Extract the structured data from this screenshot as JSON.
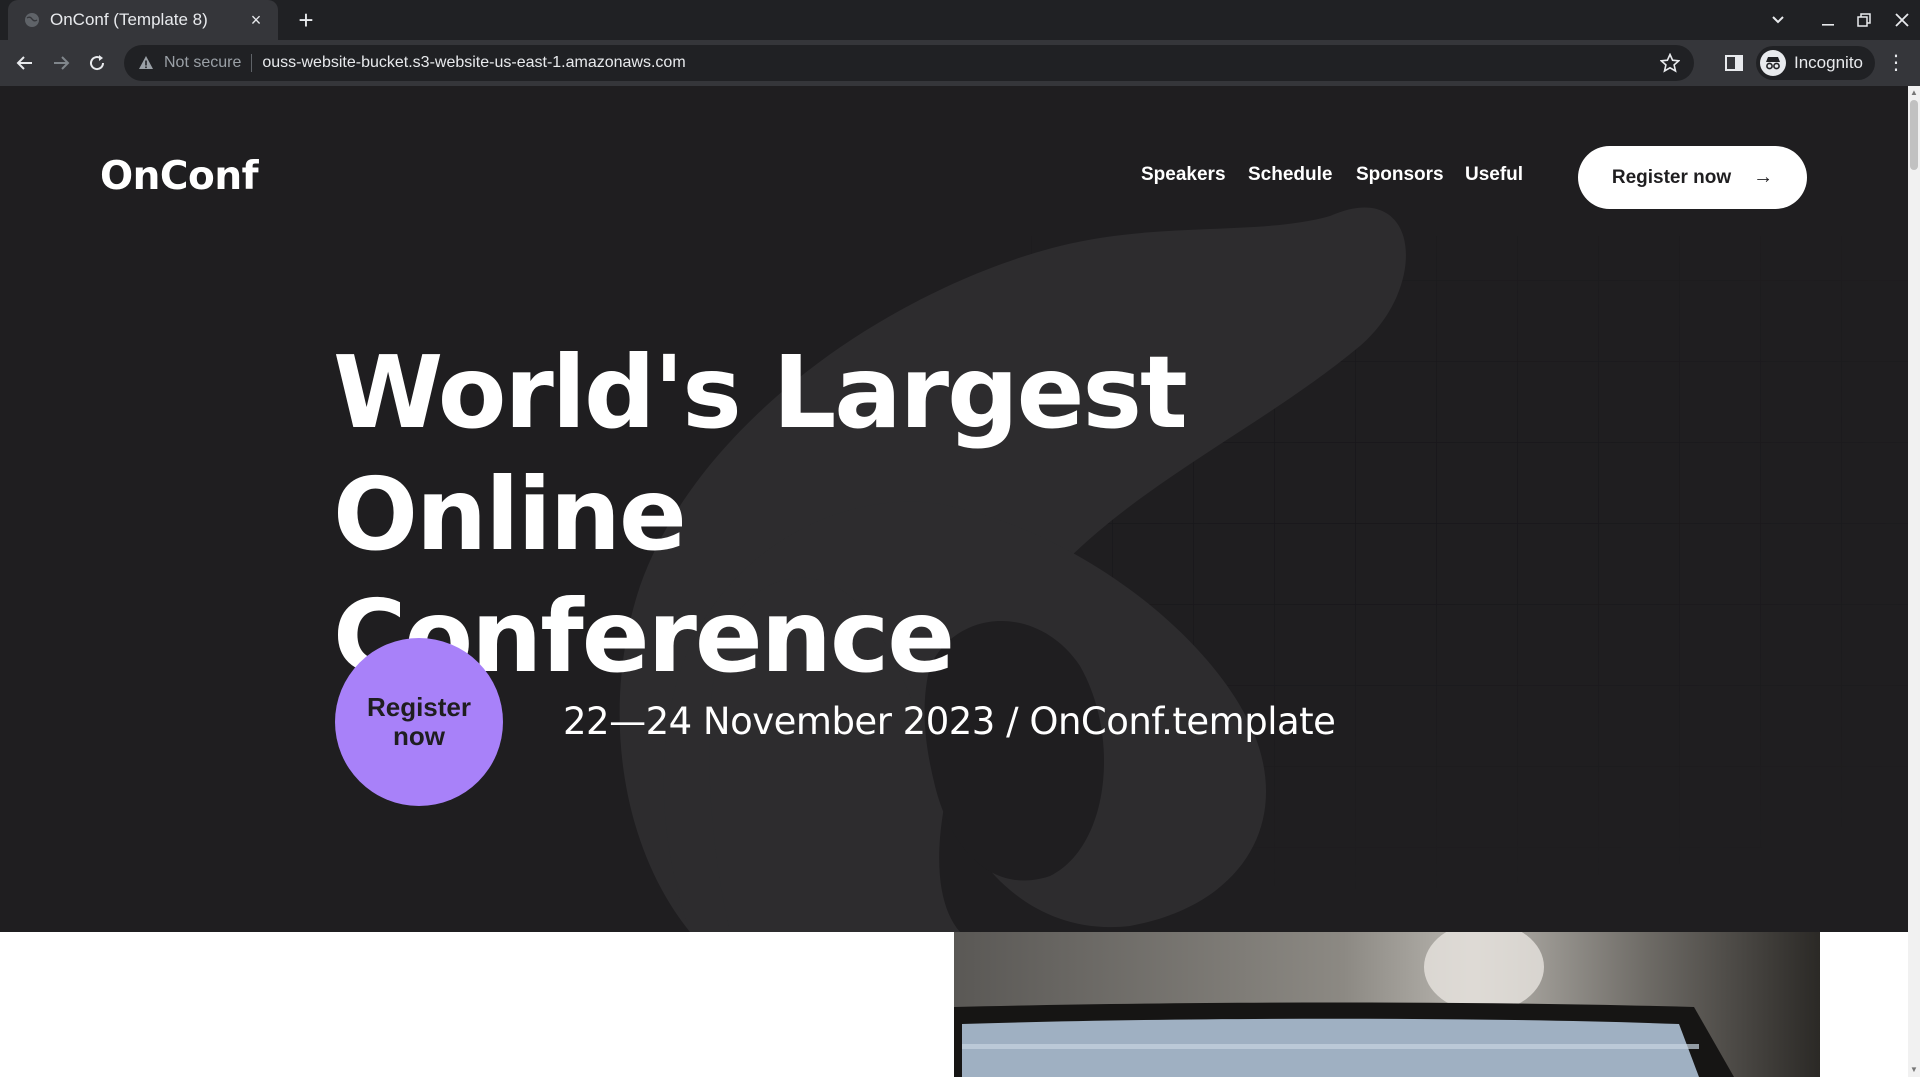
{
  "browser": {
    "tab_title": "OnConf (Template 8)",
    "tab_close": "×",
    "new_tab": "+",
    "security_label": "Not secure",
    "url": "ouss-website-bucket.s3-website-us-east-1.amazonaws.com",
    "profile_label": "Incognito",
    "menu_glyph": "⋮"
  },
  "site": {
    "logo": "OnConf",
    "nav": [
      "Speakers",
      "Schedule",
      "Sponsors",
      "Useful"
    ],
    "header_cta": "Register now",
    "header_cta_arrow": "→",
    "headline_line1": "World's Largest Online",
    "headline_line2": "Conference",
    "circle_cta_line1": "Register",
    "circle_cta_line2": "now",
    "dateline": "22—24 November 2023 / OnConf.template"
  },
  "colors": {
    "hero_background": "#1f1e20",
    "accent_purple": "#a881f9",
    "text_white": "#ffffff"
  }
}
